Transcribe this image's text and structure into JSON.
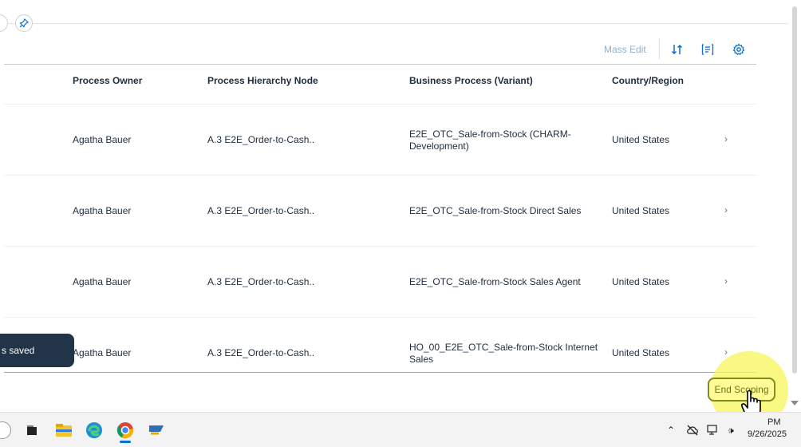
{
  "toolbar": {
    "mass_edit_label": "Mass Edit",
    "sort_icon": "sort-icon",
    "group_icon": "group-icon",
    "settings_icon": "gear-icon"
  },
  "table": {
    "columns": [
      "Process Owner",
      "Process Hierarchy Node",
      "Business Process (Variant)",
      "Country/Region"
    ],
    "rows": [
      {
        "owner": "Agatha Bauer",
        "node": "A.3 E2E_Order-to-Cash..",
        "process": "E2E_OTC_Sale-from-Stock (CHARM-Development)",
        "country": "United States"
      },
      {
        "owner": "Agatha Bauer",
        "node": "A.3 E2E_Order-to-Cash..",
        "process": "E2E_OTC_Sale-from-Stock Direct Sales",
        "country": "United States"
      },
      {
        "owner": "Agatha Bauer",
        "node": "A.3 E2E_Order-to-Cash..",
        "process": "E2E_OTC_Sale-from-Stock Sales Agent",
        "country": "United States"
      },
      {
        "owner": "Agatha Bauer",
        "node": "A.3 E2E_Order-to-Cash..",
        "process": "HO_00_E2E_OTC_Sale-from-Stock Internet Sales",
        "country": "United States"
      }
    ]
  },
  "toast": {
    "message": "s saved"
  },
  "footer": {
    "end_scoping_label": "End Scoping"
  },
  "taskbar": {
    "apps": [
      "file-explorer",
      "edge-browser",
      "chrome-browser",
      "sap-app"
    ],
    "clock_time": "PM",
    "clock_date": "9/26/2025"
  },
  "colors": {
    "accent": "#0a6ed1",
    "toast_bg": "#223548",
    "highlight": "#f5f55a",
    "button_border": "#7f8c1f"
  }
}
